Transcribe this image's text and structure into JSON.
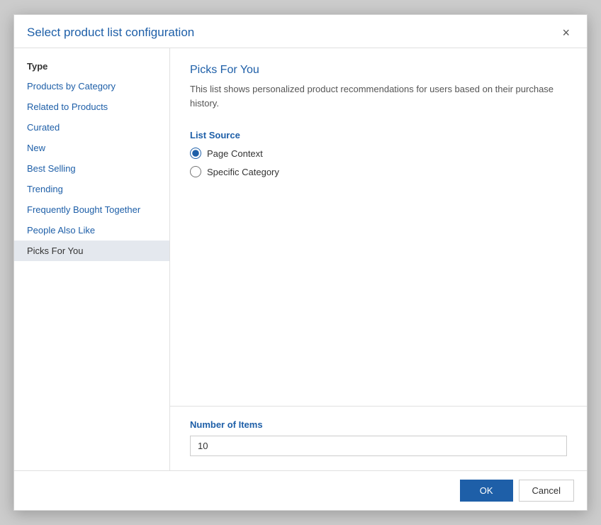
{
  "dialog": {
    "title": "Select product list configuration",
    "close_label": "×"
  },
  "sidebar": {
    "section_label": "Type",
    "items": [
      {
        "id": "products-by-category",
        "label": "Products by Category",
        "active": false
      },
      {
        "id": "related-to-products",
        "label": "Related to Products",
        "active": false
      },
      {
        "id": "curated",
        "label": "Curated",
        "active": false
      },
      {
        "id": "new",
        "label": "New",
        "active": false
      },
      {
        "id": "best-selling",
        "label": "Best Selling",
        "active": false
      },
      {
        "id": "trending",
        "label": "Trending",
        "active": false
      },
      {
        "id": "frequently-bought-together",
        "label": "Frequently Bought Together",
        "active": false
      },
      {
        "id": "people-also-like",
        "label": "People Also Like",
        "active": false
      },
      {
        "id": "picks-for-you",
        "label": "Picks For You",
        "active": true
      }
    ]
  },
  "main": {
    "selected_title": "Picks For You",
    "description": "This list shows personalized product recommendations for users based on their purchase history.",
    "list_source_label": "List Source",
    "radio_options": [
      {
        "id": "page-context",
        "label": "Page Context",
        "checked": true
      },
      {
        "id": "specific-category",
        "label": "Specific Category",
        "checked": false
      }
    ],
    "number_of_items_label": "Number of Items",
    "number_of_items_value": "10"
  },
  "footer": {
    "ok_label": "OK",
    "cancel_label": "Cancel"
  }
}
